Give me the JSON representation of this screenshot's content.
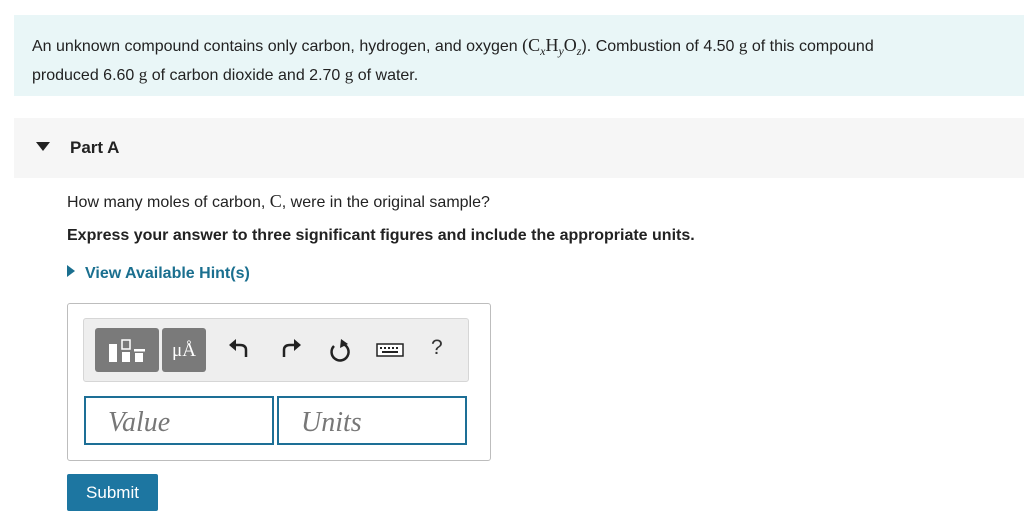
{
  "problem": {
    "text_before": "An unknown compound contains only carbon, hydrogen, and oxygen",
    "formula_open": "(",
    "formula_c": "C",
    "formula_x": "x",
    "formula_h": "H",
    "formula_y": "y",
    "formula_o": "O",
    "formula_z": "z",
    "formula_close": ").",
    "text_mid1": "Combustion of 4.50",
    "unit_g1": "g",
    "text_mid2": "of this compound",
    "text_line2a": "produced 6.60",
    "unit_g2": "g",
    "text_line2b": "of carbon dioxide and 2.70",
    "unit_g3": "g",
    "text_line2c": "of water."
  },
  "part": {
    "title": "Part A"
  },
  "question": {
    "text_before": "How many moles of carbon,",
    "symbol": "C",
    "text_after": ", were in the original sample?",
    "instruction": "Express your answer to three significant figures and include the appropriate units."
  },
  "hints": {
    "label": "View Available Hint(s)"
  },
  "toolbar": {
    "units_label": "μÅ",
    "help_label": "?"
  },
  "answer": {
    "value_placeholder": "Value",
    "units_placeholder": "Units"
  },
  "submit": {
    "label": "Submit"
  }
}
